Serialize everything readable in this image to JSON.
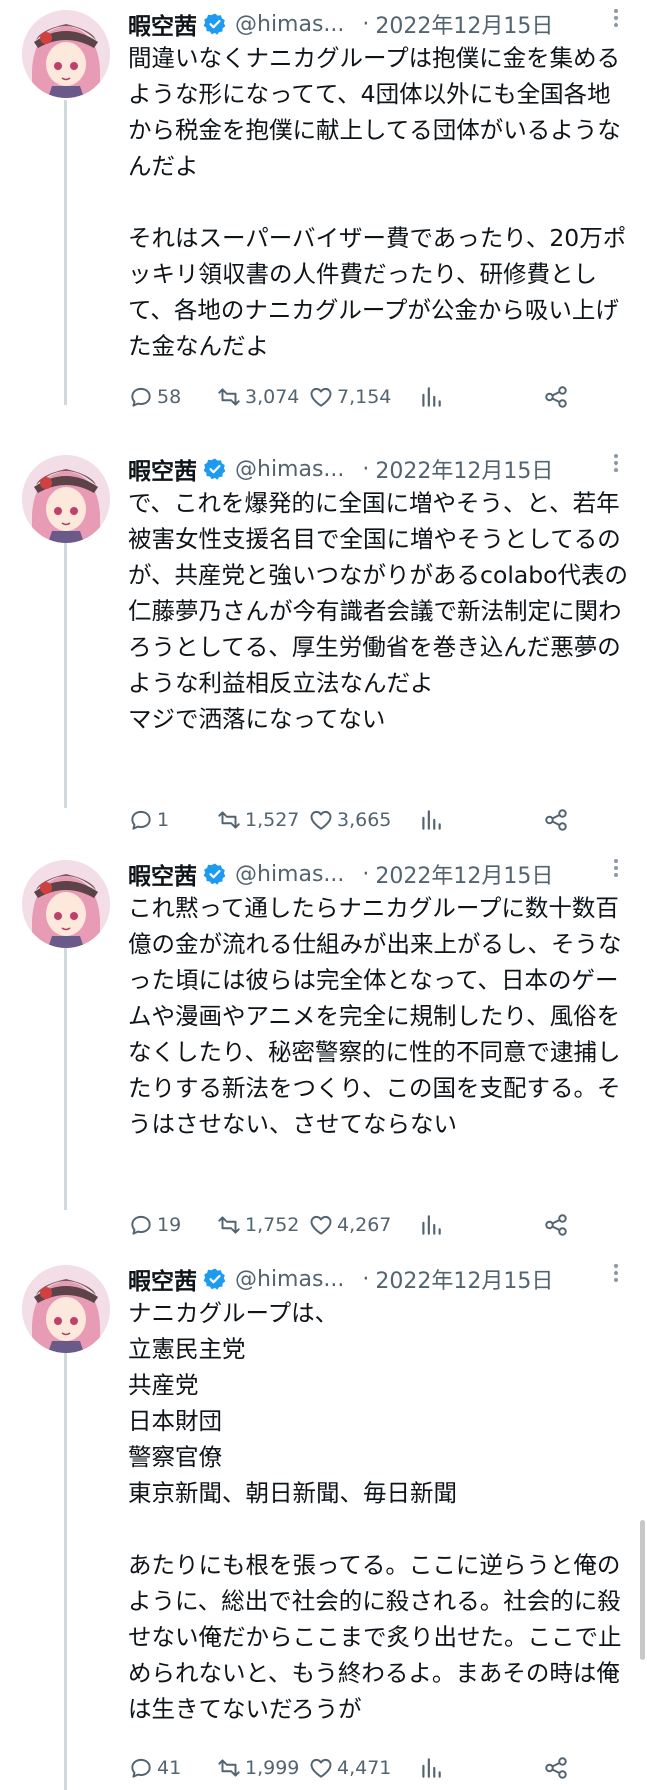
{
  "tweets": [
    {
      "name": "暇空茜",
      "handle": "@himas...",
      "separator": "·",
      "date": "2022年12月15日",
      "text": "間違いなくナニカグループは抱僕に金を集めるような形になってて、4団体以外にも全国各地から税金を抱僕に献上してる団体がいるようなんだよ\n\nそれはスーパーバイザー費であったり、20万ポッキリ領収書の人件費だったり、研修費として、各地のナニカグループが公金から吸い上げた金なんだよ",
      "replies": "58",
      "retweets": "3,074",
      "likes": "7,154"
    },
    {
      "name": "暇空茜",
      "handle": "@himas...",
      "separator": "·",
      "date": "2022年12月15日",
      "text": "で、これを爆発的に全国に増やそう、と、若年被害女性支援名目で全国に増やそうとしてるのが、共産党と強いつながりがあるcolabo代表の仁藤夢乃さんが今有識者会議で新法制定に関わろうとしてる、厚生労働省を巻き込んだ悪夢のような利益相反立法なんだよ\nマジで洒落になってない",
      "replies": "1",
      "retweets": "1,527",
      "likes": "3,665"
    },
    {
      "name": "暇空茜",
      "handle": "@himas...",
      "separator": "·",
      "date": "2022年12月15日",
      "text": "これ黙って通したらナニカグループに数十数百億の金が流れる仕組みが出来上がるし、そうなった頃には彼らは完全体となって、日本のゲームや漫画やアニメを完全に規制したり、風俗をなくしたり、秘密警察的に性的不同意で逮捕したりする新法をつくり、この国を支配する。そうはさせない、させてならない",
      "replies": "19",
      "retweets": "1,752",
      "likes": "4,267"
    },
    {
      "name": "暇空茜",
      "handle": "@himas...",
      "separator": "·",
      "date": "2022年12月15日",
      "text": "ナニカグループは、\n立憲民主党\n共産党\n日本財団\n警察官僚\n東京新聞、朝日新聞、毎日新聞\n\nあたりにも根を張ってる。ここに逆らうと俺のように、総出で社会的に殺される。社会的に殺せない俺だからここまで炙り出せた。ここで止められないと、もう終わるよ。まあその時は俺は生きてないだろうが",
      "replies": "41",
      "retweets": "1,999",
      "likes": "4,471"
    }
  ]
}
